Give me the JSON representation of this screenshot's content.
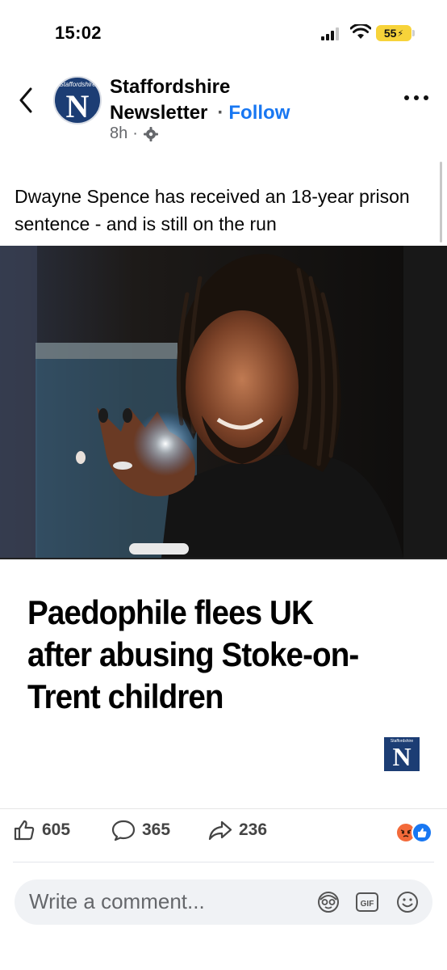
{
  "status": {
    "time": "15:02",
    "battery": "55"
  },
  "post": {
    "page_name_line1": "Staffordshire",
    "page_name_line2": "Newsletter",
    "follow_label": "Follow",
    "separator": "·",
    "timestamp": "8h",
    "meta_separator": "·",
    "avatar_small_text": "Staffordshire",
    "avatar_letter": "N",
    "caption": "Dwayne Spence has received an 18-year prison sentence - and is still on the run"
  },
  "article": {
    "headline": "Paedophile flees UK after abusing Stoke-on-Trent children",
    "logo_small_text": "Staffordshire",
    "logo_letter": "N"
  },
  "engagement": {
    "likes": "605",
    "comments": "365",
    "shares": "236"
  },
  "composer": {
    "placeholder": "Write a comment..."
  },
  "icons": {
    "back": "chevron-left-icon",
    "verified": "verified-badge-icon",
    "audience": "gear-icon",
    "more": "more-horizontal-icon",
    "like": "thumbs-up-icon",
    "comment": "comment-bubble-icon",
    "share": "share-arrow-icon",
    "avatar_sticker": "avatar-sticker-icon",
    "gif": "gif-icon",
    "emoji": "smiley-icon"
  },
  "colors": {
    "accent": "#1877f2",
    "brand_navy": "#1c3d74",
    "battery": "#f7d33a",
    "angry": "#f36a3a"
  }
}
